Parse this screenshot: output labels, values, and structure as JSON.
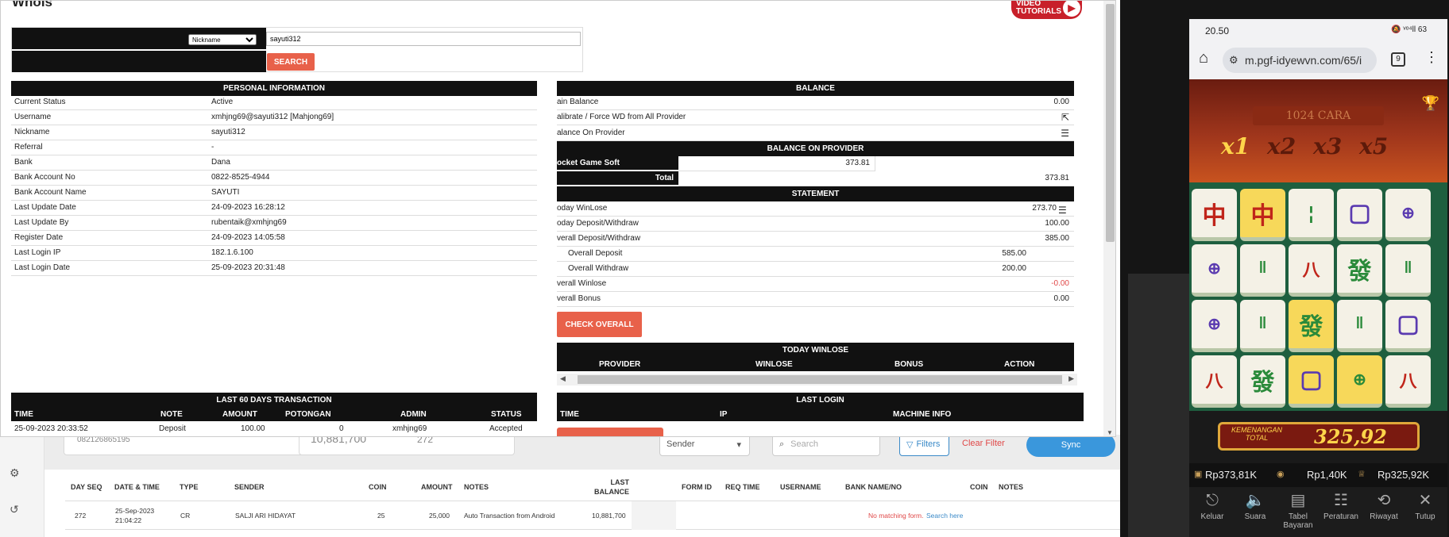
{
  "modal": {
    "title": "Whois",
    "video_badge": "VIDEO\nTUTORIALS",
    "search": {
      "select_value": "Nickname",
      "input_value": "sayuti312",
      "button": "SEARCH"
    },
    "personal": {
      "header": "PERSONAL INFORMATION",
      "rows": [
        {
          "k": "Current Status",
          "v": "Active"
        },
        {
          "k": "Username",
          "v": "xmhjng69@sayuti312  [Mahjong69]"
        },
        {
          "k": "Nickname",
          "v": "sayuti312"
        },
        {
          "k": "Referral",
          "v": "-"
        },
        {
          "k": "Bank",
          "v": "Dana"
        },
        {
          "k": "Bank Account No",
          "v": "0822-8525-4944"
        },
        {
          "k": "Bank Account Name",
          "v": "SAYUTI"
        },
        {
          "k": "Last Update Date",
          "v": "24-09-2023 16:28:12"
        },
        {
          "k": "Last Update By",
          "v": "rubentaik@xmhjng69"
        },
        {
          "k": "Register Date",
          "v": "24-09-2023 14:05:58"
        },
        {
          "k": "Last Login IP",
          "v": "182.1.6.100"
        },
        {
          "k": "Last Login Date",
          "v": "25-09-2023 20:31:48"
        }
      ]
    },
    "balance": {
      "header": "BALANCE",
      "main_label": "ain Balance",
      "main_value": "0.00",
      "calibrate_label": "alibrate / Force WD from All Provider",
      "on_provider_label": "alance On Provider",
      "bop_header": "BALANCE ON PROVIDER",
      "provider_name": "ocket Game Soft",
      "provider_value": "373.81",
      "total_label": "Total",
      "total_value": "373.81"
    },
    "statement": {
      "header": "STATEMENT",
      "rows": [
        {
          "k": "oday WinLose",
          "v": "273.70"
        },
        {
          "k": "oday Deposit/Withdraw",
          "v": "100.00"
        },
        {
          "k": "verall Deposit/Withdraw",
          "v": "385.00"
        },
        {
          "k": "Overall Deposit",
          "v": "585.00"
        },
        {
          "k": "Overall Withdraw",
          "v": "200.00"
        },
        {
          "k": "verall Winlose",
          "v": "-0.00"
        },
        {
          "k": "verall Bonus",
          "v": "0.00"
        }
      ],
      "check_button": "CHECK OVERALL"
    },
    "today_winlose": {
      "header": "TODAY WINLOSE",
      "cols": [
        "PROVIDER",
        "WINLOSE",
        "BONUS",
        "ACTION"
      ]
    },
    "last60": {
      "header": "LAST 60 DAYS TRANSACTION",
      "cols": [
        "TIME",
        "NOTE",
        "AMOUNT",
        "POTONGAN",
        "ADMIN",
        "STATUS"
      ],
      "row": [
        "25-09-2023 20:33:52",
        "Deposit",
        "100.00",
        "0",
        "xmhjng69",
        "Accepted"
      ]
    },
    "last_login": {
      "header": "LAST LOGIN",
      "cols": [
        "TIME",
        "IP",
        "MACHINE INFO"
      ]
    }
  },
  "background": {
    "card1": "082126865195",
    "card2_a": "10,881,700",
    "card2_b": "272",
    "sender_select": "Sender",
    "search_placeholder": "Search",
    "filters": "Filters",
    "clear_filter": "Clear Filter",
    "sync": "Sync",
    "cols": {
      "day_seq": "DAY SEQ",
      "date_time": "DATE & TIME",
      "type": "TYPE",
      "sender": "SENDER",
      "coin": "COIN",
      "amount": "AMOUNT",
      "notes": "NOTES",
      "last_balance": "LAST\nBALANCE",
      "form_id": "FORM ID",
      "req_time": "REQ TIME",
      "username": "USERNAME",
      "bank": "BANK NAME/NO",
      "coin2": "COIN",
      "notes2": "NOTES"
    },
    "row": {
      "day_seq": "272",
      "date_time": "25-Sep-2023\n21:04:22",
      "type": "CR",
      "sender": "SALJI ARI HIDAYAT",
      "coin": "25",
      "amount": "25,000",
      "notes": "Auto Transaction from Android",
      "last_balance": "10,881,700",
      "no_match": "No matching form.",
      "search_here": "Search here"
    }
  },
  "phone": {
    "time": "20.50",
    "status_icons": "🔕 ᵛᵒ⁴ll 63",
    "url": "m.pgf-idyewvn.com/65/i",
    "tab_count": "9",
    "game_title": "1024 CARA",
    "multipliers": [
      "x1",
      "x2",
      "x3",
      "x5"
    ],
    "win_label": "KEMENANGAN\nTOTAL",
    "win_value": "325,92",
    "balances": [
      "Rp373,81K",
      "Rp1,40K",
      "Rp325,92K"
    ],
    "bottom": [
      "Keluar",
      "Suara",
      "Tabel\nBayaran",
      "Peraturan",
      "Riwayat",
      "Tutup"
    ]
  }
}
